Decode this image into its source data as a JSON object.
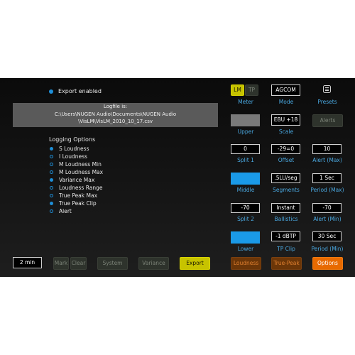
{
  "export": {
    "label": "Export enabled"
  },
  "logfile": {
    "title": "Logfile is:",
    "line1": "C:\\Users\\NUGEN Audio\\Documents\\NUGEN Audio",
    "line2": "\\VisLM\\VisLM_2010_10_17.csv"
  },
  "logging": {
    "title": "Logging Options",
    "options": [
      {
        "label": "S Loudness",
        "on": true
      },
      {
        "label": "I Loudness",
        "on": false
      },
      {
        "label": "M Loudness Min",
        "on": false
      },
      {
        "label": "M Loudness Max",
        "on": false
      },
      {
        "label": "Variance Max",
        "on": true
      },
      {
        "label": "Loudness Range",
        "on": false
      },
      {
        "label": "True Peak Max",
        "on": false
      },
      {
        "label": "True Peak Clip",
        "on": true
      },
      {
        "label": "Alert",
        "on": false
      }
    ]
  },
  "bottom": {
    "duration": "2 min",
    "mark": "Mark",
    "clear": "Clear",
    "system": "System",
    "variance": "Variance",
    "export": "Export"
  },
  "meter": {
    "lm": "LM",
    "tp": "TP",
    "caption": "Meter"
  },
  "mode": {
    "value": "AGCOM",
    "caption": "Mode"
  },
  "presets": {
    "caption": "Presets",
    "icon": "preset-list-icon"
  },
  "upper": {
    "caption": "Upper",
    "color": "#7a7a7a"
  },
  "scale": {
    "value": "EBU +18",
    "caption": "Scale"
  },
  "alerts": {
    "label": "Alerts"
  },
  "split1": {
    "value": "0",
    "caption": "Split 1"
  },
  "offset": {
    "value": "-29=0",
    "caption": "Offset"
  },
  "alert_max": {
    "value": "10",
    "caption": "Alert (Max)"
  },
  "middle": {
    "caption": "Middle",
    "color": "#1a9ae8"
  },
  "segments": {
    "value": ".5LU/seg",
    "caption": "Segments"
  },
  "period_max": {
    "value": "1 Sec",
    "caption": "Period (Max)"
  },
  "split2": {
    "value": "-70",
    "caption": "Split 2"
  },
  "ballistics": {
    "value": "Instant",
    "caption": "Ballistics"
  },
  "alert_min": {
    "value": "-70",
    "caption": "Alert (Min)"
  },
  "lower": {
    "caption": "Lower",
    "color": "#1a9ae8"
  },
  "tp_clip": {
    "value": "-1 dBTP",
    "caption": "TP Clip"
  },
  "period_min": {
    "value": "30 Sec",
    "caption": "Period (Min)"
  },
  "tabs": {
    "loudness": "Loudness",
    "true_peak": "True-Peak",
    "options": "Options"
  }
}
